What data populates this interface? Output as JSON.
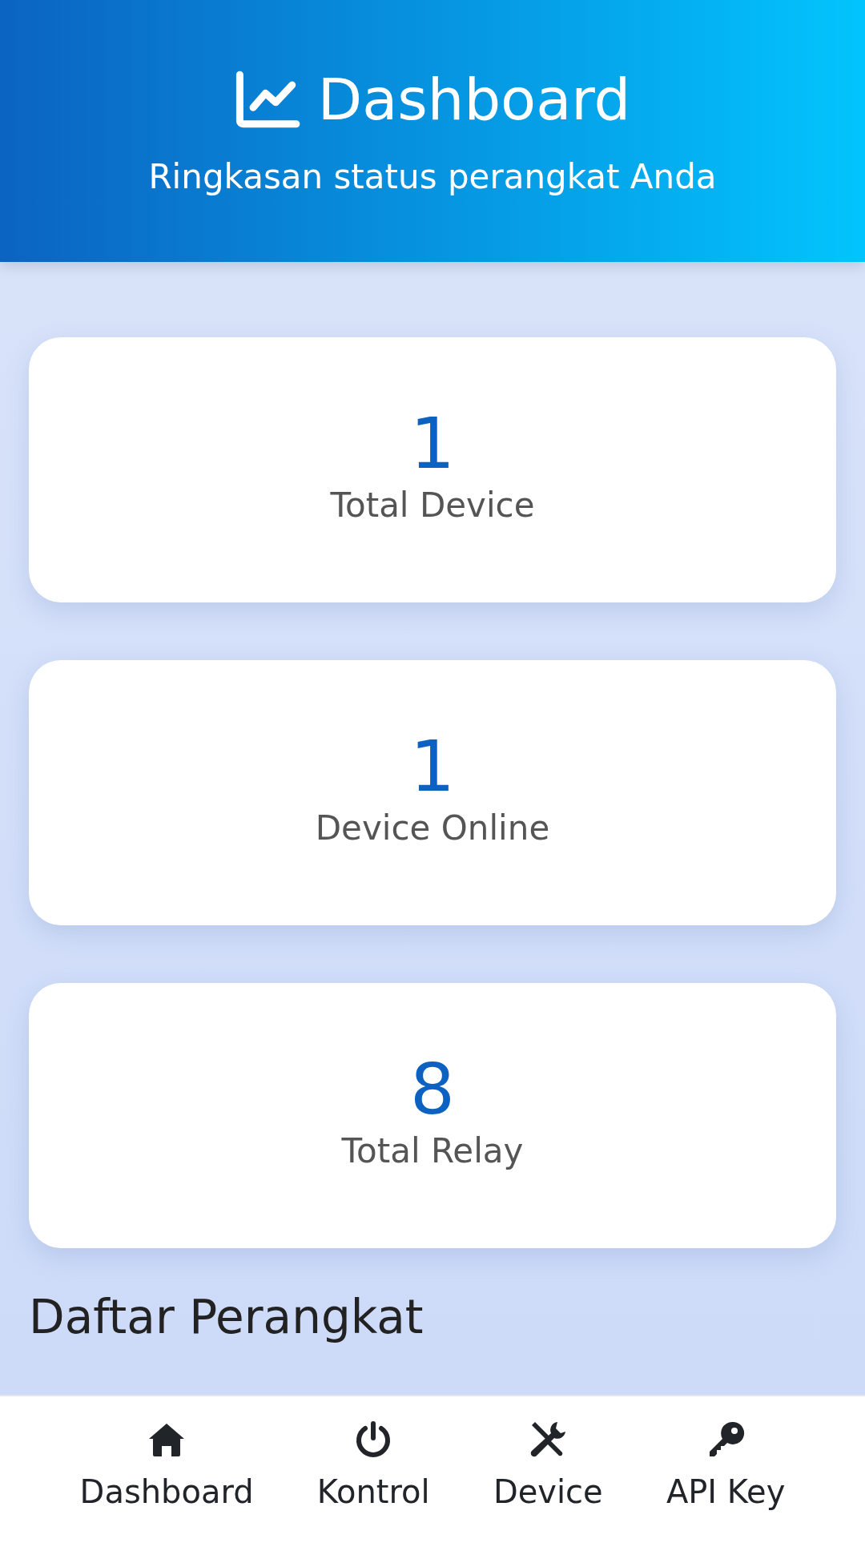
{
  "header": {
    "title": "Dashboard",
    "subtitle": "Ringkasan status perangkat Anda"
  },
  "stats": [
    {
      "value": "1",
      "label": "Total Device"
    },
    {
      "value": "1",
      "label": "Device Online"
    },
    {
      "value": "8",
      "label": "Total Relay"
    }
  ],
  "section_title": "Daftar Perangkat",
  "bottom_nav": [
    {
      "label": "Dashboard"
    },
    {
      "label": "Kontrol"
    },
    {
      "label": "Device"
    },
    {
      "label": "API Key"
    }
  ]
}
